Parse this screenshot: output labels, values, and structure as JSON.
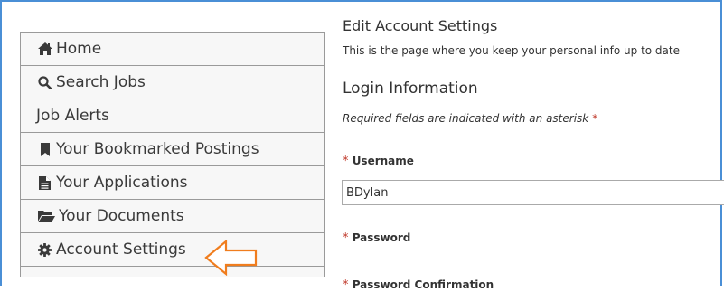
{
  "sidebar": {
    "items": [
      {
        "label": "Home",
        "icon": "home-icon"
      },
      {
        "label": "Search Jobs",
        "icon": "search-icon"
      },
      {
        "label": "Job Alerts",
        "icon": ""
      },
      {
        "label": "Your Bookmarked Postings",
        "icon": "bookmark-icon"
      },
      {
        "label": "Your Applications",
        "icon": "file-icon"
      },
      {
        "label": "Your Documents",
        "icon": "folder-open-icon"
      },
      {
        "label": "Account Settings",
        "icon": "gear-icon"
      }
    ]
  },
  "main": {
    "title": "Edit Account Settings",
    "description": "This is the page where you keep your personal info up to date",
    "section_title": "Login Information",
    "required_note": "Required fields are indicated with an asterisk",
    "asterisk": "*",
    "fields": {
      "username_label": "Username",
      "username_value": "BDylan",
      "password_label": "Password",
      "password_confirm_label": "Password Confirmation"
    }
  },
  "colors": {
    "frame_border": "#4a8fd6",
    "arrow": "#f07d1e",
    "required": "#c0392b"
  }
}
